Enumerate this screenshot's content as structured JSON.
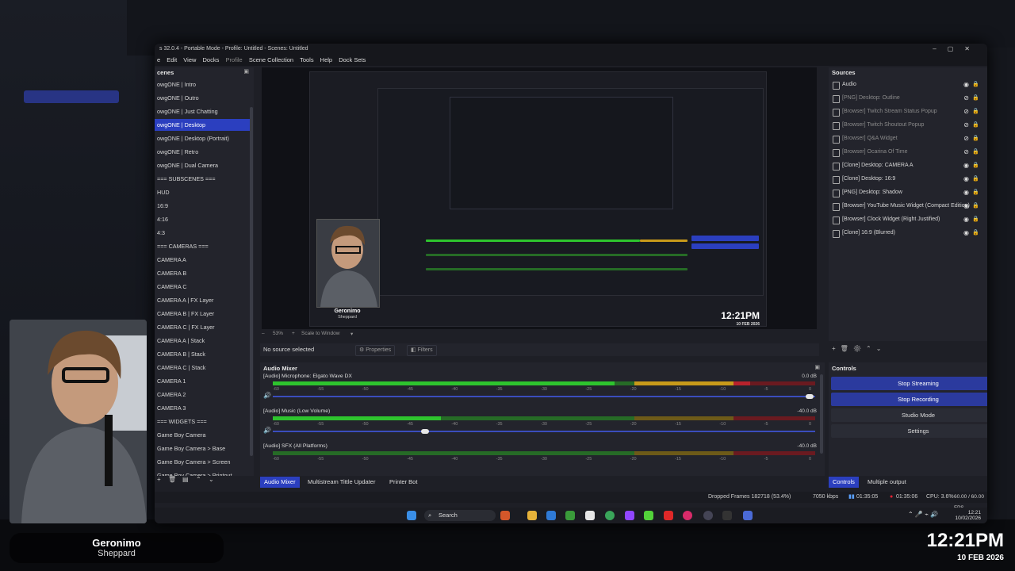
{
  "window": {
    "title": "s 32.0.4 - Portable Mode - Profile: Untitled - Scenes: Untitled",
    "menu": [
      "e",
      "Edit",
      "View",
      "Docks",
      "Profile",
      "Scene Collection",
      "Tools",
      "Help",
      "Dock Sets"
    ]
  },
  "scenes": {
    "header": "cenes",
    "items": [
      "owgONE | Intro",
      "owgONE | Outro",
      "owgONE | Just Chatting",
      "owgONE | Desktop",
      "owgONE | Desktop (Portrait)",
      "owgONE | Retro",
      "owgONE | Dual Camera",
      "=== SUBSCENES ===",
      "HUD",
      "16:9",
      "4:16",
      "4:3",
      "=== CAMERAS ===",
      "CAMERA A",
      "CAMERA B",
      "CAMERA C",
      "CAMERA A | FX Layer",
      "CAMERA B | FX Layer",
      "CAMERA C | FX Layer",
      "CAMERA A | Stack",
      "CAMERA B | Stack",
      "CAMERA C | Stack",
      "CAMERA 1",
      "CAMERA 2",
      "CAMERA 3",
      "=== WIDGETS ===",
      "Game Boy Camera",
      "Game Boy Camera > Base",
      "Game Boy Camera > Screen",
      "Game Boy Camera > Printout"
    ],
    "selected_index": 3
  },
  "preview": {
    "zoom": "53%",
    "scale_mode": "Scale to Window",
    "nested_camera_name": "Geronimo",
    "nested_camera_sub": "Sheppard",
    "nested_clock": "12:21PM",
    "nested_date": "10 FEB 2026"
  },
  "source_bar": {
    "no_source": "No source selected",
    "properties": "Properties",
    "filters": "Filters"
  },
  "mixer": {
    "header": "Audio Mixer",
    "ticks": [
      "-60",
      "-55",
      "-50",
      "-45",
      "-40",
      "-35",
      "-30",
      "-25",
      "-20",
      "-15",
      "-10",
      "-5",
      "0"
    ],
    "channels": [
      {
        "name": "[Audio] Microphone: Elgato Wave DX",
        "db": "0.0 dB",
        "level": 0.63,
        "volume": 0.99
      },
      {
        "name": "[Audio] Music (Low Volume)",
        "db": "-40.0 dB",
        "level": 0.31,
        "volume": 0.28
      },
      {
        "name": "[Audio] SFX (All Platforms)",
        "db": "-40.0 dB",
        "level": 0.0,
        "volume": 0.0
      }
    ]
  },
  "bottom_tabs": [
    "Audio Mixer",
    "Multistream Tittle Updater",
    "Printer Bot"
  ],
  "sources": {
    "header": "Sources",
    "items": [
      {
        "label": "Audio",
        "visible": true
      },
      {
        "label": "[PNG] Desktop: Outline",
        "visible": false
      },
      {
        "label": "[Browser] Twitch Stream Status Popup",
        "visible": false
      },
      {
        "label": "[Browser] Twitch Shoutout Popup",
        "visible": false
      },
      {
        "label": "[Browser] Q&A Widget",
        "visible": false
      },
      {
        "label": "[Browser] Ocarina Of Time",
        "visible": false
      },
      {
        "label": "[Clone] Desktop: CAMERA A",
        "visible": true
      },
      {
        "label": "[Clone] Desktop: 16:9",
        "visible": true
      },
      {
        "label": "[PNG] Desktop: Shadow",
        "visible": true
      },
      {
        "label": "[Browser] YouTube Music Widget (Compact Edition)",
        "visible": true
      },
      {
        "label": "[Browser] Clock Widget (Right Justified)",
        "visible": true
      },
      {
        "label": "[Clone] 16:9 (Blurred)",
        "visible": true
      }
    ]
  },
  "controls": {
    "header": "Controls",
    "stop_streaming": "Stop Streaming",
    "stop_recording": "Stop Recording",
    "studio_mode": "Studio Mode",
    "settings": "Settings",
    "tabs": [
      "Controls",
      "Multiple output"
    ]
  },
  "status": {
    "dropped": "Dropped Frames 182718 (53.4%)",
    "bitrate": "7050 kbps",
    "stream_time": "01:35:05",
    "rec_time": "01:35:06",
    "cpu": "CPU: 3.6%",
    "fps": "60.00 / 60.00 FPS"
  },
  "taskbar": {
    "search": "Search",
    "time": "12:21",
    "date": "10/02/2026"
  },
  "overlay": {
    "name": "Geronimo",
    "sub": "Sheppard",
    "clock": "12:21PM",
    "date": "10 FEB 2026"
  },
  "colors": {
    "accent": "#2b3fbf",
    "meter_green": "#2ec42e",
    "meter_yellow": "#c89a1a",
    "meter_red": "#b8222c"
  }
}
